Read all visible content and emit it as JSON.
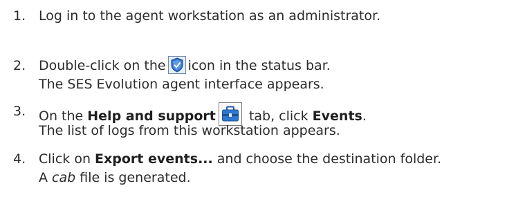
{
  "steps": [
    {
      "number": "1.",
      "text": "Log in to the agent workstation as an administrator."
    },
    {
      "number": "2.",
      "line1_before": "Double-click on the",
      "icon": "ses-shield-icon",
      "line1_after": "icon in the status bar.",
      "line2": "The SES Evolution agent interface appears."
    },
    {
      "number": "3.",
      "line1_prefix": "On the ",
      "line1_bold": "Help and support",
      "icon": "toolbox-icon",
      "line1_mid": "tab, click ",
      "line1_bold2": "Events",
      "line1_end": ".",
      "line2": "The list of logs from this workstation appears."
    },
    {
      "number": "4.",
      "line1_prefix": "Click on ",
      "line1_bold": "Export events...",
      "line1_after": " and choose the destination folder.",
      "line2_prefix": "A ",
      "line2_italic": "cab",
      "line2_after": " file is generated."
    }
  ]
}
